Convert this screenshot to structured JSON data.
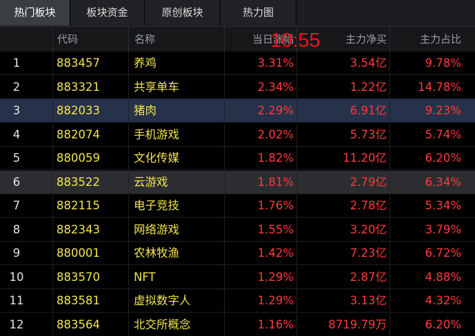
{
  "tabs": [
    "热门板块",
    "板块资金",
    "原创板块",
    "热力图"
  ],
  "header": {
    "code": "代码",
    "name": "名称",
    "change": "当日涨幅",
    "net_buy": "主力净买",
    "ratio": "主力占比"
  },
  "clock": "10:55",
  "colors": {
    "up": "#ff3b3b",
    "name_code": "#f2e64a",
    "selected_row": "#26314a",
    "hover_row": "#2b2d31"
  },
  "selected_row_index": 3,
  "hover_row_index": 6,
  "rows": [
    {
      "idx": "1",
      "code": "883457",
      "name": "养鸡",
      "change": "3.31%",
      "net_buy": "3.54亿",
      "ratio": "9.78%"
    },
    {
      "idx": "2",
      "code": "883321",
      "name": "共享单车",
      "change": "2.34%",
      "net_buy": "1.22亿",
      "ratio": "14.78%"
    },
    {
      "idx": "3",
      "code": "882033",
      "name": "猪肉",
      "change": "2.29%",
      "net_buy": "6.91亿",
      "ratio": "9.23%"
    },
    {
      "idx": "4",
      "code": "882074",
      "name": "手机游戏",
      "change": "2.02%",
      "net_buy": "5.73亿",
      "ratio": "5.74%"
    },
    {
      "idx": "5",
      "code": "880059",
      "name": "文化传媒",
      "change": "1.82%",
      "net_buy": "11.20亿",
      "ratio": "6.20%"
    },
    {
      "idx": "6",
      "code": "883522",
      "name": "云游戏",
      "change": "1.81%",
      "net_buy": "2.79亿",
      "ratio": "6.34%"
    },
    {
      "idx": "7",
      "code": "882115",
      "name": "电子竞技",
      "change": "1.76%",
      "net_buy": "2.78亿",
      "ratio": "5.34%"
    },
    {
      "idx": "8",
      "code": "882343",
      "name": "网络游戏",
      "change": "1.55%",
      "net_buy": "3.20亿",
      "ratio": "3.79%"
    },
    {
      "idx": "9",
      "code": "880001",
      "name": "农林牧渔",
      "change": "1.42%",
      "net_buy": "7.23亿",
      "ratio": "6.72%"
    },
    {
      "idx": "10",
      "code": "883570",
      "name": "NFT",
      "change": "1.29%",
      "net_buy": "2.87亿",
      "ratio": "4.88%"
    },
    {
      "idx": "11",
      "code": "883581",
      "name": "虚拟数字人",
      "change": "1.29%",
      "net_buy": "3.13亿",
      "ratio": "4.32%"
    },
    {
      "idx": "12",
      "code": "883564",
      "name": "北交所概念",
      "change": "1.16%",
      "net_buy": "8719.79万",
      "ratio": "6.20%"
    }
  ]
}
